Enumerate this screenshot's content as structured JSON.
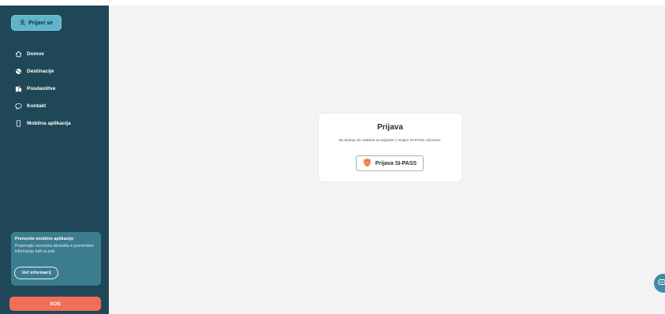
{
  "sidebar": {
    "login_label": "Prijavi se",
    "nav": [
      {
        "label": "Domov",
        "icon": "home-icon"
      },
      {
        "label": "Destinacije",
        "icon": "globe-icon"
      },
      {
        "label": "Posdaniltve",
        "icon": "office-icon"
      },
      {
        "label": "Kontakt",
        "icon": "chat-icon"
      },
      {
        "label": "Mobilna aplikacija",
        "icon": "phone-icon"
      }
    ],
    "promo": {
      "title": "Prenesite mobilno aplikacijo",
      "text": "Prejemajte varnostna obvestila in pomembne informacije tudi na poti.",
      "button_label": "Več informacij"
    },
    "sos_label": "SOS"
  },
  "login_card": {
    "title": "Prijava",
    "subtitle": "Za dostop do vsebine se prijavite z svojim SI-PASS računom.",
    "button_label": "Prijava SI-PASS"
  },
  "colors": {
    "sidebar_bg": "#1f4757",
    "accent": "#5fb4c8",
    "sos": "#f16e57",
    "page_bg": "#f3f3f3"
  }
}
